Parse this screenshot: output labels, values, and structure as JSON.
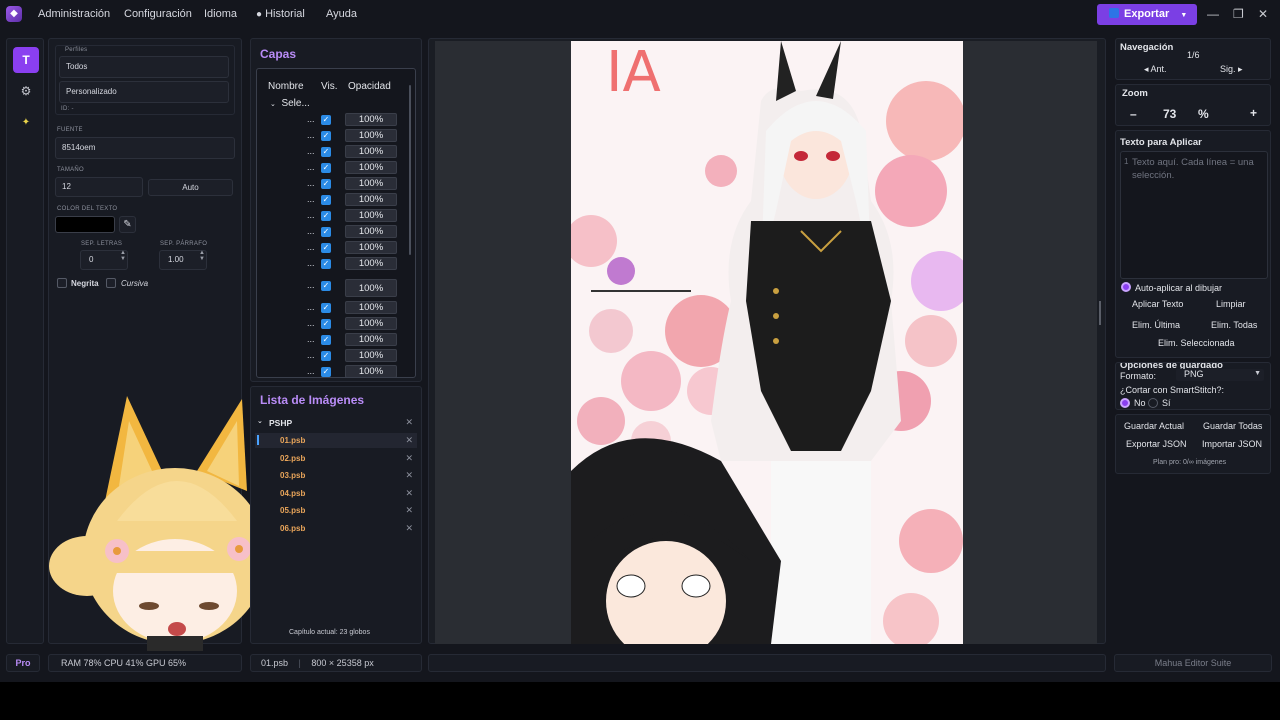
{
  "menubar": {
    "items": [
      "Administración",
      "Configuración",
      "Idioma",
      "Historial",
      "Ayuda"
    ],
    "export_label": "Exportar"
  },
  "properties": {
    "profiles_label": "Perfiles",
    "profile_all": "Todos",
    "profile_custom": "Personalizado",
    "id_label": "ID: -",
    "font_label": "FUENTE",
    "font_value": "8514oem",
    "size_label": "TAMAÑO",
    "size_value": "12",
    "size_auto": "Auto",
    "color_label": "COLOR DEL TEXTO",
    "color_value": "#000000",
    "letter_spacing_label": "SEP. LETRAS",
    "letter_spacing_value": "0",
    "paragraph_spacing_label": "SEP. PÁRRAFO",
    "paragraph_spacing_value": "1.00",
    "bold_label": "Negrita",
    "italic_label": "Cursiva"
  },
  "layers": {
    "title": "Capas",
    "col_name": "Nombre",
    "col_visible": "Vis.",
    "col_opacity": "Opacidad",
    "group_label": "Sele...",
    "row_name": "...",
    "opacity_values": [
      "100%",
      "100%",
      "100%",
      "100%",
      "100%",
      "100%",
      "100%",
      "100%",
      "100%",
      "100%",
      "100%",
      "100%",
      "100%",
      "100%",
      "100%",
      "100%",
      "100%"
    ]
  },
  "images": {
    "title": "Lista de Imágenes",
    "folder": "PSHP",
    "files": [
      "01.psb",
      "02.psb",
      "03.psb",
      "04.psb",
      "05.psb",
      "06.psb"
    ],
    "selected_index": 0,
    "chapter_info": "Capítulo actual: 23 globos"
  },
  "navigation": {
    "title": "Navegación",
    "page_indicator": "1/6",
    "prev_label": "◂ Ant.",
    "next_label": "Sig. ▸"
  },
  "zoom": {
    "title": "Zoom",
    "minus": "–",
    "value": "73",
    "unit": "%",
    "plus": "+"
  },
  "text_apply": {
    "title": "Texto para Aplicar",
    "line_number": "1",
    "placeholder": "Texto aquí. Cada línea = una selección.",
    "auto_apply_label": "Auto-aplicar al dibujar",
    "apply_btn": "Aplicar Texto",
    "clear_btn": "Limpiar",
    "delete_last": "Elim. Última",
    "delete_all": "Elim. Todas",
    "delete_selected": "Elim. Seleccionada"
  },
  "save_options": {
    "title": "Opciones de guardado",
    "format_label": "Formato:",
    "format_value": "PNG",
    "smartstitch_label": "¿Cortar con SmartStitch?:",
    "opt_no": "No",
    "opt_yes": "Sí",
    "save_current": "Guardar Actual",
    "save_all": "Guardar Todas",
    "export_json": "Exportar JSON",
    "import_json": "Importar JSON",
    "plan_info": "Plan pro: 0/∞ imágenes"
  },
  "status": {
    "pro_label": "Pro",
    "resources": "RAM 78%   CPU 41%   GPU 65%",
    "file": "01.psb",
    "dimensions": "800 × 25358 px",
    "app_name": "Mahua Editor Suite"
  },
  "canvas": {
    "title_fragment": "IA"
  },
  "colors": {
    "accent": "#8a3ff0",
    "title_purple": "#b98cf7",
    "file_orange": "#e9a55a",
    "checkbox_blue": "#2b8be6"
  }
}
